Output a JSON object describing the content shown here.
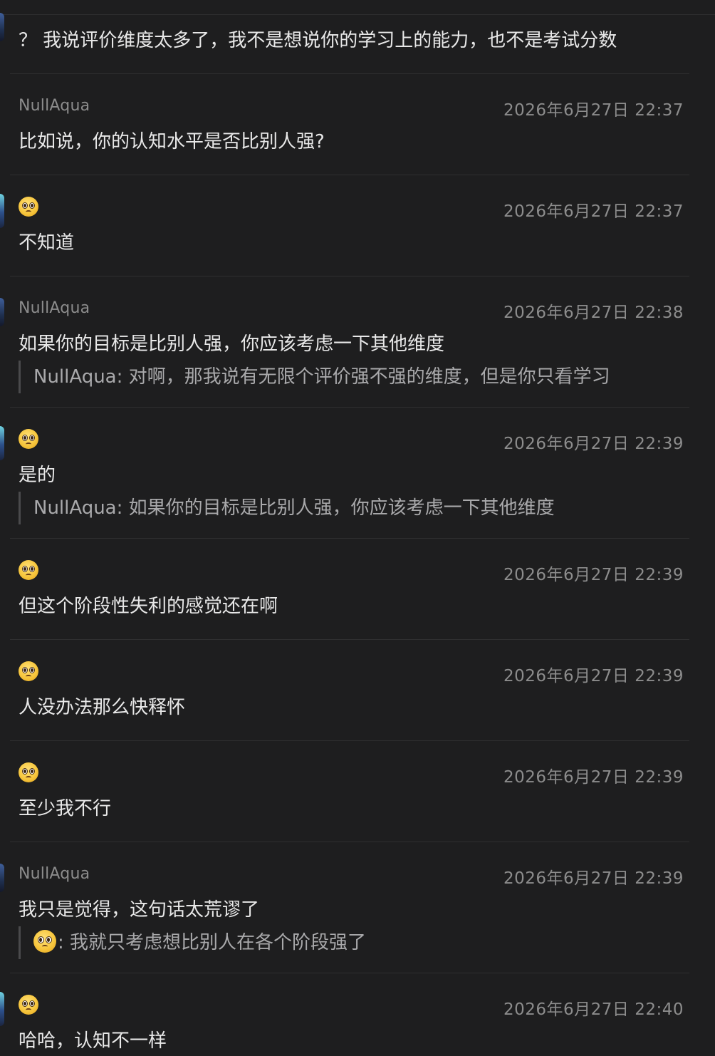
{
  "messages": [
    {
      "sender": "",
      "avatar": "none",
      "time": "",
      "text": "？ 我说评价维度太多了，我不是想说你的学习上的能力，也不是考试分数",
      "quote": null
    },
    {
      "sender": "NullAqua",
      "avatar": "none",
      "time": "2026年6月27日 22:37",
      "text": "比如说，你的认知水平是否比别人强?",
      "quote": null
    },
    {
      "sender": "",
      "avatar": "pleading-face-emoji",
      "time": "2026年6月27日 22:37",
      "text": "不知道",
      "quote": null
    },
    {
      "sender": "NullAqua",
      "avatar": "none",
      "time": "2026年6月27日 22:38",
      "text": "如果你的目标是比别人强，你应该考虑一下其他维度",
      "quote": {
        "author": "NullAqua",
        "author_emoji": false,
        "text": ": 对啊，那我说有无限个评价强不强的维度，但是你只看学习"
      }
    },
    {
      "sender": "",
      "avatar": "pleading-face-emoji",
      "time": "2026年6月27日 22:39",
      "text": "是的",
      "quote": {
        "author": "NullAqua",
        "author_emoji": false,
        "text": ": 如果你的目标是比别人强，你应该考虑一下其他维度"
      }
    },
    {
      "sender": "",
      "avatar": "pleading-face-emoji",
      "time": "2026年6月27日 22:39",
      "text": "但这个阶段性失利的感觉还在啊",
      "quote": null
    },
    {
      "sender": "",
      "avatar": "pleading-face-emoji",
      "time": "2026年6月27日 22:39",
      "text": "人没办法那么快释怀",
      "quote": null
    },
    {
      "sender": "",
      "avatar": "pleading-face-emoji",
      "time": "2026年6月27日 22:39",
      "text": "至少我不行",
      "quote": null
    },
    {
      "sender": "NullAqua",
      "avatar": "none",
      "time": "2026年6月27日 22:39",
      "text": "我只是觉得，这句话太荒谬了",
      "quote": {
        "author": "",
        "author_emoji": true,
        "text": ": 我就只考虑想比别人在各个阶段强了"
      }
    },
    {
      "sender": "",
      "avatar": "pleading-face-emoji",
      "time": "2026年6月27日 22:40",
      "text": "哈哈，认知不一样",
      "quote": null
    }
  ],
  "colors": {
    "background": "#1e1e1f",
    "text": "#e8e8e8",
    "muted": "#8c8c8c",
    "quote_text": "#a9a9ab",
    "separator": "#2f2f30"
  }
}
